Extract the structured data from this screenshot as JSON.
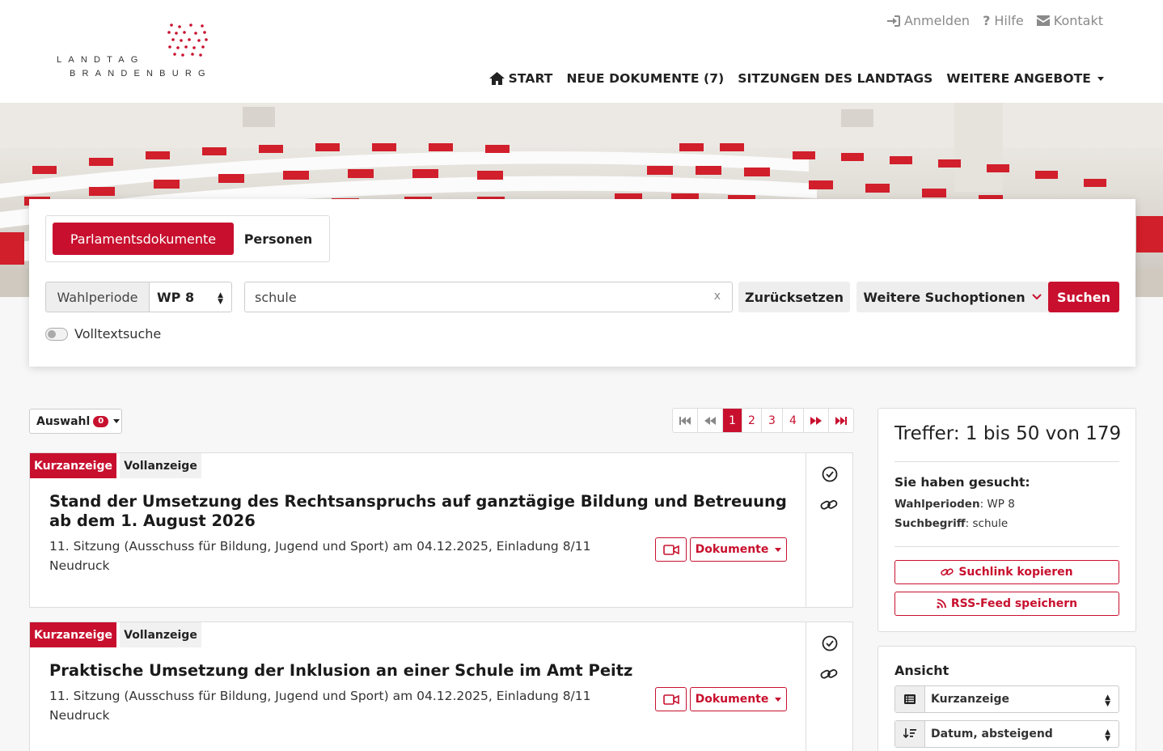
{
  "brand": {
    "line1": "LANDTAG",
    "line2": "BRANDENBURG"
  },
  "topnav": {
    "login": "Anmelden",
    "help": "Hilfe",
    "contact": "Kontakt"
  },
  "mainnav": {
    "start": "START",
    "new_docs": "NEUE DOKUMENTE (7)",
    "sessions": "SITZUNGEN DES LANDTAGS",
    "more": "WEITERE ANGEBOTE"
  },
  "search": {
    "tab_active": "Parlamentsdokumente",
    "tab_inactive": "Personen",
    "period_label": "Wahlperiode",
    "period_value": "WP 8",
    "query": "schule",
    "clear": "x",
    "reset": "Zurücksetzen",
    "more_options": "Weitere Suchoptionen",
    "submit": "Suchen",
    "fulltext_label": "Volltextsuche"
  },
  "selection": {
    "label": "Auswahl",
    "count": "0"
  },
  "pagination": {
    "pages": [
      "1",
      "2",
      "3",
      "4"
    ],
    "current": "1"
  },
  "results": [
    {
      "tab_short": "Kurzanzeige",
      "tab_full": "Vollanzeige",
      "title": "Stand der Umsetzung des Rechtsanspruchs auf ganztägige Bildung und Betreuung ab dem 1. August 2026",
      "meta_line1": "11. Sitzung (Ausschuss für Bildung, Jugend und Sport) am 04.12.2025, Einladung 8/11",
      "meta_line2": "Neudruck",
      "docs_label": "Dokumente"
    },
    {
      "tab_short": "Kurzanzeige",
      "tab_full": "Vollanzeige",
      "title": "Praktische Umsetzung der Inklusion an einer Schule im Amt Peitz",
      "meta_line1": "11. Sitzung (Ausschuss für Bildung, Jugend und Sport) am 04.12.2025, Einladung 8/11",
      "meta_line2": "Neudruck",
      "docs_label": "Dokumente"
    }
  ],
  "summary": {
    "hits": "Treffer: 1 bis 50 von 179",
    "searched_heading": "Sie haben gesucht:",
    "periods_key": "Wahlperioden",
    "periods_val": "WP 8",
    "term_key": "Suchbegriff",
    "term_val": "schule",
    "copy_link": "Suchlink kopieren",
    "rss": "RSS-Feed speichern"
  },
  "view": {
    "heading": "Ansicht",
    "display": "Kurzanzeige",
    "sort": "Datum, absteigend"
  },
  "colors": {
    "accent": "#c8102e"
  }
}
